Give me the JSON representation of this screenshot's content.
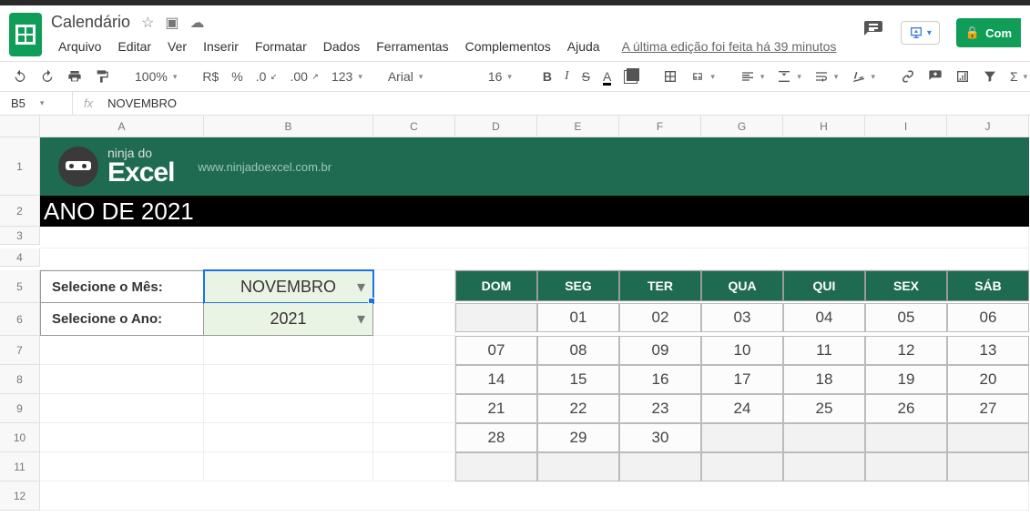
{
  "doc": {
    "title": "Calendário"
  },
  "menus": [
    "Arquivo",
    "Editar",
    "Ver",
    "Inserir",
    "Formatar",
    "Dados",
    "Ferramentas",
    "Complementos",
    "Ajuda"
  ],
  "edit_status": "A última edição foi feita há 39 minutos",
  "share_label": "Com",
  "toolbar": {
    "zoom": "100%",
    "currency": "R$",
    "percent": "%",
    "dec_dec": ".0",
    "dec_inc": ".00",
    "numfmt": "123",
    "font": "Arial",
    "size": "16"
  },
  "namebox": {
    "ref": "B5",
    "fx": "fx",
    "value": "NOVEMBRO"
  },
  "columns": [
    "A",
    "B",
    "C",
    "D",
    "E",
    "F",
    "G",
    "H",
    "I",
    "J"
  ],
  "rows": [
    "1",
    "2",
    "3",
    "4",
    "5",
    "6",
    "7",
    "8",
    "9",
    "10",
    "11",
    "12"
  ],
  "banner": {
    "line1": "ninja do",
    "line2": "Excel",
    "url": "www.ninjadoexcel.com.br"
  },
  "year_title": "ANO DE 2021",
  "select_month_label": "Selecione o Mês:",
  "select_month_value": "NOVEMBRO",
  "select_year_label": "Selecione o Ano:",
  "select_year_value": "2021",
  "cal_headers": [
    "DOM",
    "SEG",
    "TER",
    "QUA",
    "QUI",
    "SEX",
    "SÁB"
  ],
  "cal_rows": [
    [
      "",
      "01",
      "02",
      "03",
      "04",
      "05",
      "06"
    ],
    [
      "07",
      "08",
      "09",
      "10",
      "11",
      "12",
      "13"
    ],
    [
      "14",
      "15",
      "16",
      "17",
      "18",
      "19",
      "20"
    ],
    [
      "21",
      "22",
      "23",
      "24",
      "25",
      "26",
      "27"
    ],
    [
      "28",
      "29",
      "30",
      "",
      "",
      "",
      ""
    ],
    [
      "",
      "",
      "",
      "",
      "",
      "",
      ""
    ]
  ]
}
